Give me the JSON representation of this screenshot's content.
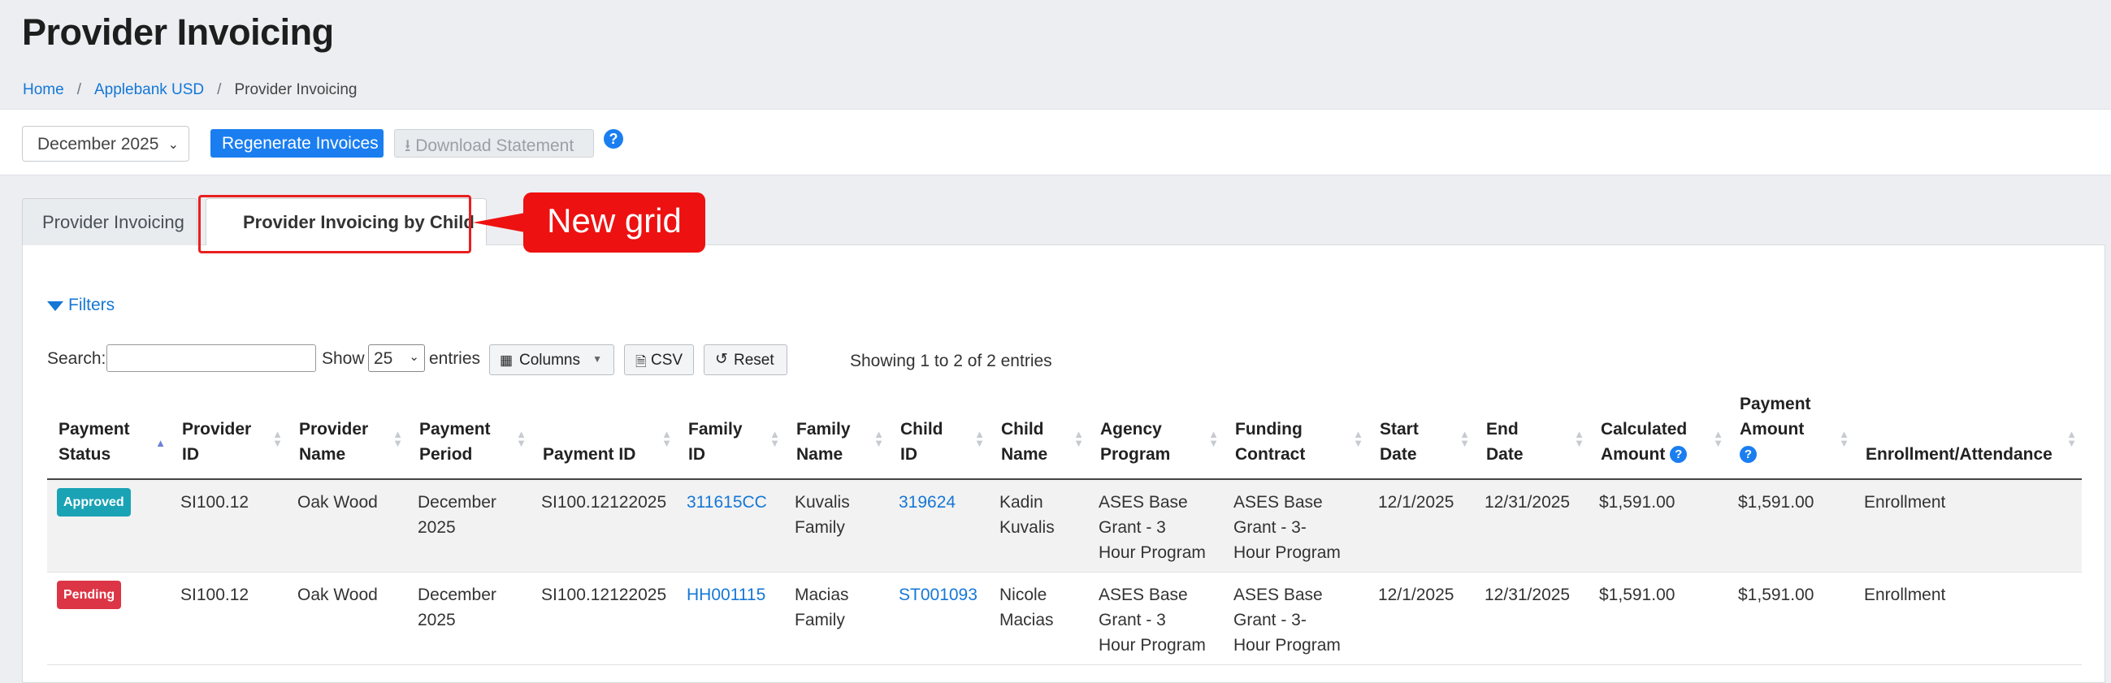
{
  "header": {
    "title": "Provider Invoicing"
  },
  "breadcrumb": {
    "home": "Home",
    "district": "Applebank USD",
    "current": "Provider Invoicing",
    "separator": "/"
  },
  "toolbar": {
    "month_value": "December 2025",
    "regenerate_label": "Regenerate Invoices",
    "download_label": "Download Statement",
    "help_symbol": "?"
  },
  "tabs": [
    {
      "label": "Provider Invoicing",
      "active": false
    },
    {
      "label": "Provider Invoicing by Child",
      "active": true
    }
  ],
  "callout": {
    "text": "New grid"
  },
  "grid_controls": {
    "filters_label": "Filters",
    "search_label": "Search:",
    "search_value": "",
    "show_label": "Show",
    "entries_value": "25",
    "entries_label": "entries",
    "columns_label": "Columns",
    "csv_label": "CSV",
    "reset_label": "Reset",
    "info_text": "Showing 1 to 2 of 2 entries"
  },
  "table": {
    "headers": [
      [
        "Payment",
        "Status"
      ],
      [
        "Provider",
        "ID"
      ],
      [
        "Provider",
        "Name"
      ],
      [
        "Payment",
        "Period"
      ],
      [
        "Payment ID"
      ],
      [
        "Family",
        "ID"
      ],
      [
        "Family",
        "Name"
      ],
      [
        "Child",
        "ID"
      ],
      [
        "Child",
        "Name"
      ],
      [
        "Agency",
        "Program"
      ],
      [
        "Funding",
        "Contract"
      ],
      [
        "Start",
        "Date"
      ],
      [
        "End",
        "Date"
      ],
      [
        "Calculated",
        "Amount"
      ],
      [
        "Payment",
        "Amount"
      ],
      [
        "Enrollment/Attendance"
      ]
    ],
    "rows": [
      {
        "status": "Approved",
        "provider_id": "SI100.12",
        "provider_name": "Oak Wood",
        "period": [
          "December",
          "2025"
        ],
        "payment_id": "SI100.12122025",
        "family_id": "311615CC",
        "family_name": [
          "Kuvalis",
          "Family"
        ],
        "child_id": "319624",
        "child_name": [
          "Kadin",
          "Kuvalis"
        ],
        "agency_program": [
          "ASES Base",
          "Grant - 3",
          "Hour Program"
        ],
        "funding_contract": [
          "ASES Base",
          "Grant - 3-",
          "Hour Program"
        ],
        "start": "12/1/2025",
        "end": "12/31/2025",
        "calculated": "$1,591.00",
        "payment": "$1,591.00",
        "enrollment": "Enrollment"
      },
      {
        "status": "Pending",
        "provider_id": "SI100.12",
        "provider_name": "Oak Wood",
        "period": [
          "December",
          "2025"
        ],
        "payment_id": "SI100.12122025",
        "family_id": "HH001115",
        "family_name": [
          "Macias",
          "Family"
        ],
        "child_id": "ST001093",
        "child_name": [
          "Nicole",
          "Macias"
        ],
        "agency_program": [
          "ASES Base",
          "Grant - 3",
          "Hour Program"
        ],
        "funding_contract": [
          "ASES Base",
          "Grant - 3-",
          "Hour Program"
        ],
        "start": "12/1/2025",
        "end": "12/31/2025",
        "calculated": "$1,591.00",
        "payment": "$1,591.00",
        "enrollment": "Enrollment"
      }
    ]
  },
  "colors": {
    "primary": "#1a7ef0",
    "callout": "#ee1111",
    "approved": "#1aa3b5",
    "pending": "#dc3545"
  }
}
